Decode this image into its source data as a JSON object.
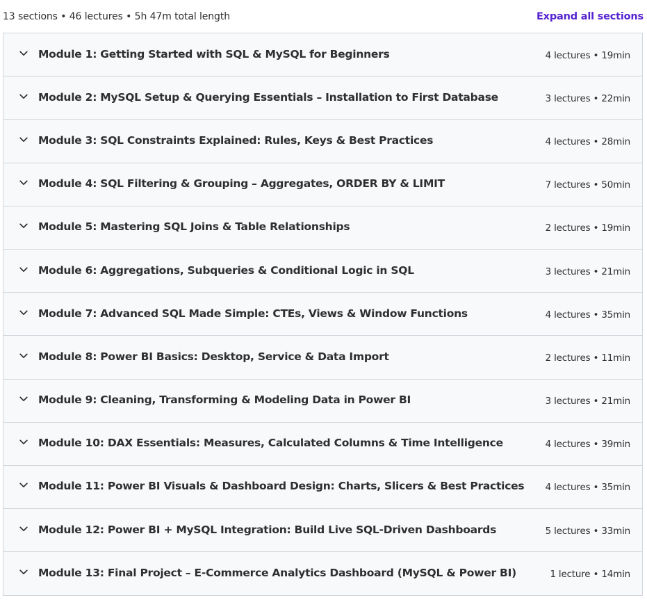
{
  "summary": {
    "text": "13 sections • 46 lectures • 5h 47m total length",
    "expand_label": "Expand all sections"
  },
  "colors": {
    "accent": "#5624d0",
    "row_bg": "#f7f9fa",
    "border": "#d1d7dc",
    "text": "#2d2f31"
  },
  "icons": {
    "section_toggle": "chevron-down-icon"
  },
  "sections": [
    {
      "title": "Module 1: Getting Started with SQL & MySQL for Beginners",
      "meta": "4 lectures • 19min"
    },
    {
      "title": "Module 2: MySQL Setup & Querying Essentials – Installation to First Database",
      "meta": "3 lectures • 22min"
    },
    {
      "title": "Module 3: SQL Constraints Explained: Rules, Keys & Best Practices",
      "meta": "4 lectures • 28min"
    },
    {
      "title": "Module 4: SQL Filtering & Grouping – Aggregates, ORDER BY & LIMIT",
      "meta": "7 lectures • 50min"
    },
    {
      "title": "Module 5: Mastering SQL Joins & Table Relationships",
      "meta": "2 lectures • 19min"
    },
    {
      "title": "Module 6: Aggregations, Subqueries & Conditional Logic in SQL",
      "meta": "3 lectures • 21min"
    },
    {
      "title": "Module 7: Advanced SQL Made Simple: CTEs, Views & Window Functions",
      "meta": "4 lectures • 35min"
    },
    {
      "title": "Module 8: Power BI Basics: Desktop, Service & Data Import",
      "meta": "2 lectures • 11min"
    },
    {
      "title": "Module 9: Cleaning, Transforming & Modeling Data in Power BI",
      "meta": "3 lectures • 21min"
    },
    {
      "title": "Module 10: DAX Essentials: Measures, Calculated Columns & Time Intelligence",
      "meta": "4 lectures • 39min"
    },
    {
      "title": "Module 11: Power BI Visuals & Dashboard Design: Charts, Slicers & Best Practices",
      "meta": "4 lectures • 35min"
    },
    {
      "title": "Module 12: Power BI + MySQL Integration: Build Live SQL-Driven Dashboards",
      "meta": "5 lectures • 33min"
    },
    {
      "title": "Module 13: Final Project – E-Commerce Analytics Dashboard (MySQL & Power BI)",
      "meta": "1 lecture • 14min"
    }
  ]
}
